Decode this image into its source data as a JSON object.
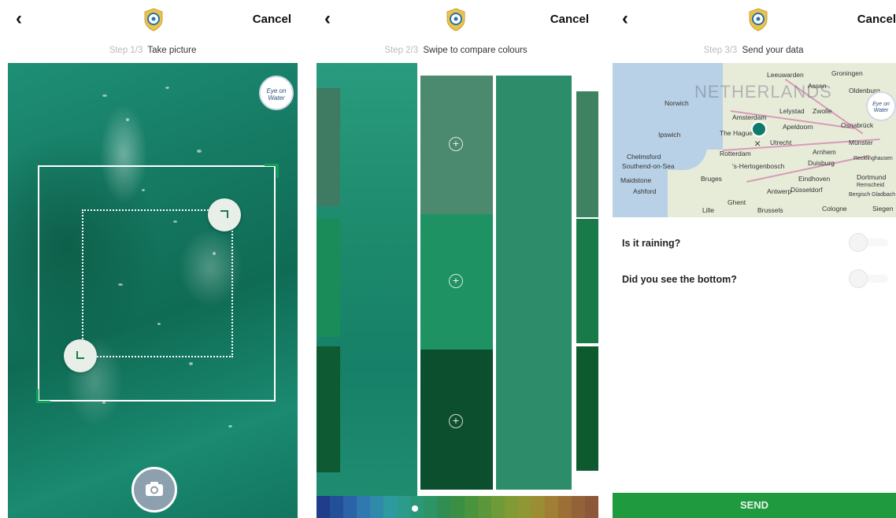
{
  "screens": {
    "take_picture": {
      "back_label": "‹",
      "cancel_label": "Cancel",
      "step_number": "Step 1/3",
      "step_text": "Take picture",
      "brand_badge_text": "Eye on Water"
    },
    "compare_colours": {
      "back_label": "‹",
      "cancel_label": "Cancel",
      "step_number": "Step 2/3",
      "step_text": "Swipe to compare colours",
      "plus_symbol": "+",
      "palette_colors": [
        "#1f3d8a",
        "#234f9a",
        "#2a63a8",
        "#2f78b0",
        "#2f8aa9",
        "#2d9aa0",
        "#2c9b8b",
        "#2a9878",
        "#2c9465",
        "#2f8e52",
        "#3a8f45",
        "#4a933f",
        "#5c963b",
        "#6f9a38",
        "#809a36",
        "#8f9634",
        "#9b8d33",
        "#a07f34",
        "#9c6f36",
        "#946238",
        "#8d5739"
      ],
      "selected_palette_index": 6
    },
    "send_data": {
      "back_label": "‹",
      "cancel_label": "Cancel",
      "step_number": "Step 3/3",
      "step_text": "Send your data",
      "map": {
        "country_label": "NETHERLANDS",
        "badge_text": "Eye on Water",
        "cities": [
          "Leeuwarden",
          "Groningen",
          "Assen",
          "Oldenburg",
          "Norwich",
          "Amsterdam",
          "Lelystad",
          "Zwolle",
          "Apeldoorn",
          "Osnabrück",
          "Ipswich",
          "The Hague",
          "Utrecht",
          "Münster",
          "Chelmsford",
          "Rotterdam",
          "Arnhem",
          "Recklinghausen",
          "Southend-on-Sea",
          "'s-Hertogenbosch",
          "Duisburg",
          "Maidstone",
          "Bruges",
          "Eindhoven",
          "Dortmund",
          "Ashford",
          "Antwerp",
          "Düsseldorf",
          "Remscheid",
          "Ghent",
          "Bergisch Gladbach",
          "Lille",
          "Brussels",
          "Cologne",
          "Siegen"
        ]
      },
      "question_raining": "Is it raining?",
      "question_bottom": "Did you see the bottom?",
      "send_label": "SEND"
    }
  }
}
